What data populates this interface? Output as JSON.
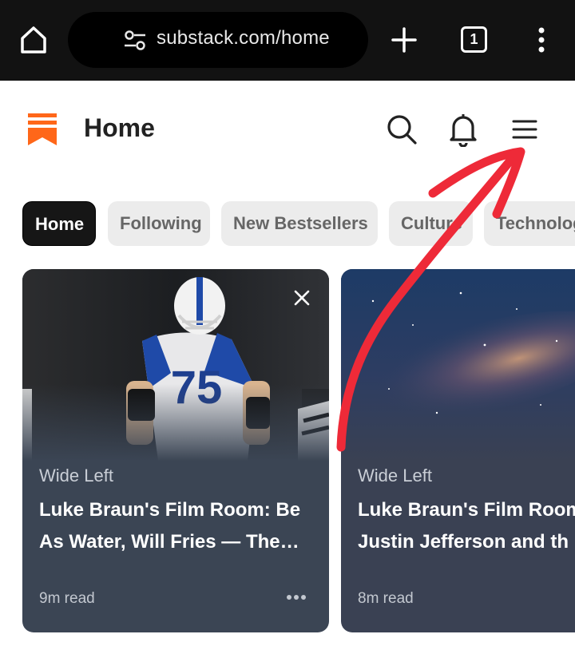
{
  "browser": {
    "url": "substack.com/home",
    "tab_count": "1"
  },
  "header": {
    "title": "Home"
  },
  "categories": [
    {
      "label": "Home",
      "active": true
    },
    {
      "label": "Following",
      "active": false
    },
    {
      "label": "New Bestsellers",
      "active": false
    },
    {
      "label": "Culture",
      "active": false
    },
    {
      "label": "Technology",
      "active": false
    }
  ],
  "cards": [
    {
      "publication": "Wide Left",
      "title": "Luke Braun's Film Room: Be As Water, Will Fries — The…",
      "read_time": "9m read",
      "jersey_number": "75"
    },
    {
      "publication": "Wide Left",
      "title": "Luke Braun's Film Room",
      "title_line2": "Justin Jefferson and th",
      "read_time": "8m read"
    }
  ],
  "colors": {
    "brand": "#ff6719",
    "annotation": "#ee2a38",
    "card_bg": "#3b4554"
  },
  "icons": [
    "home-icon",
    "tune-icon",
    "plus-icon",
    "tab-switcher-icon",
    "kebab-icon",
    "substack-logo",
    "search-icon",
    "bell-icon",
    "hamburger-menu-icon",
    "close-icon",
    "more-icon"
  ]
}
